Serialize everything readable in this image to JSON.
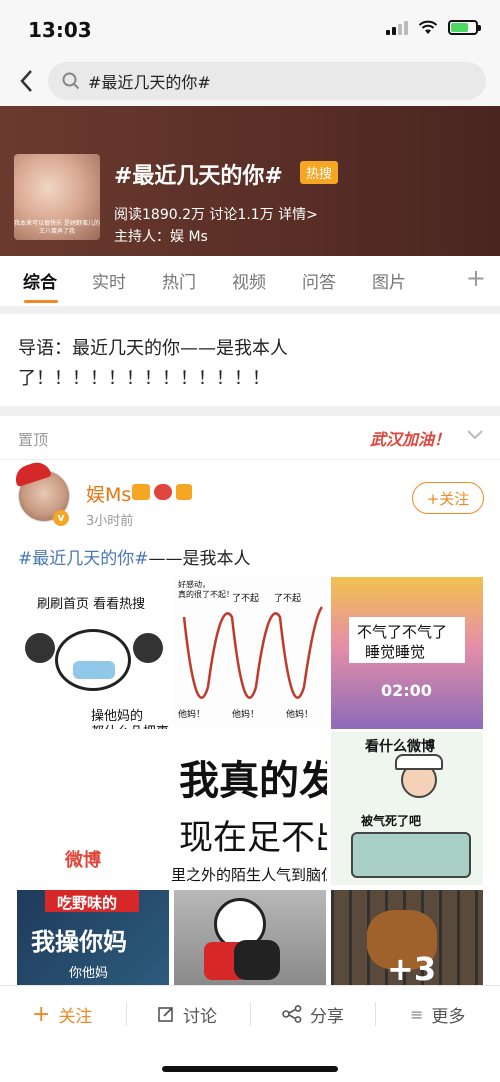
{
  "status_bar": {
    "time": "13:03"
  },
  "search": {
    "query": "#最近几天的你#"
  },
  "topic": {
    "title": "#最近几天的你#",
    "hot_badge": "热搜",
    "stats": "阅读1890.2万  讨论1.1万  详情>",
    "host": "主持人：娱 Ms",
    "thumb_caption": "我本来可以很快乐 是她野蛮儿的王八蛋弄了我"
  },
  "tabs": [
    "综合",
    "实时",
    "热门",
    "视频",
    "问答",
    "图片"
  ],
  "intro": {
    "line1": "导语：最近几天的你——是我本人",
    "line2": "了！！！！！！！！！！！！！"
  },
  "pinned": {
    "label": "置顶",
    "banner": "武汉加油！"
  },
  "post": {
    "author": "娱Ms",
    "time": "3小时前",
    "follow_label": "+关注",
    "hashtag": "#最近几天的你#",
    "text_rest": "——是我本人",
    "images": {
      "img1_top": "刷刷首页  看看热搜",
      "img1_bottom": "操他妈的",
      "img1_bottom2": "都什么几把事",
      "img2_top": "好感动，",
      "img2_top2": "真的很了不起！",
      "img2_labels": [
        "了不起",
        "了不起"
      ],
      "img2_bottom": [
        "他妈！",
        "他妈！",
        "他妈！"
      ],
      "img3_top": "不气了不气了",
      "img3_top2": "睡觉睡觉",
      "img3_time": "02:00",
      "img_mid_l1": "我真的发",
      "img_mid_l2": "现在足不出",
      "img_mid_l3": "里之外的陌生人气到脑仁",
      "weibo": "微博",
      "img4_top": "看什么微博",
      "img4_mid": "被气死了吧",
      "img5_l1": "吃野味的",
      "img5_l2": "我操你妈",
      "img5_l3": "你他妈",
      "more": "+3"
    }
  },
  "bottom_bar": {
    "follow": "关注",
    "discuss": "讨论",
    "share": "分享",
    "more": "更多"
  }
}
